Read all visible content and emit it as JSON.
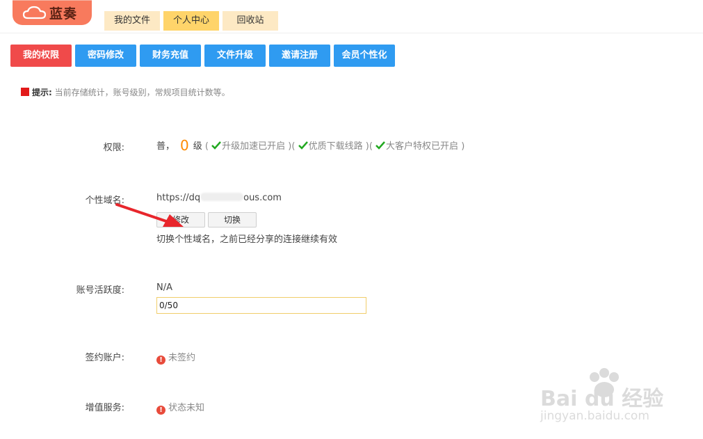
{
  "header": {
    "logo_text": "蓝奏",
    "tabs": [
      {
        "label": "我的文件"
      },
      {
        "label": "个人中心",
        "active": true
      },
      {
        "label": "回收站"
      }
    ]
  },
  "actions": [
    {
      "label": "我的权限",
      "active": true
    },
    {
      "label": "密码修改"
    },
    {
      "label": "财务充值"
    },
    {
      "label": "文件升级"
    },
    {
      "label": "邀请注册"
    },
    {
      "label": "会员个性化"
    }
  ],
  "tip": {
    "prefix": "提示:",
    "text": "当前存储统计，账号级别，常规项目统计数等。"
  },
  "permission": {
    "label": "权限:",
    "tier": "普，",
    "level": "0",
    "level_unit": "级",
    "open_paren": "(",
    "features": [
      "升级加速已开启",
      "优质下载线路",
      "大客户特权已开启"
    ],
    "close_paren": ")"
  },
  "domain": {
    "label": "个性域名:",
    "url_start": "https://dq",
    "url_end": "ous.com",
    "modify_button": "修改",
    "switch_button": "切换",
    "note": "切换个性域名，之前已经分享的连接继续有效"
  },
  "activity": {
    "label": "账号活跃度:",
    "value": "N/A",
    "progress_text": "0/50"
  },
  "contract": {
    "label": "签约账户:",
    "status": "未签约"
  },
  "value_added": {
    "label": "增值服务:",
    "status": "状态未知"
  },
  "watermark": {
    "brand": "Bai du 经验",
    "url": "jingyan.baidu.com"
  },
  "colors": {
    "accent_blue": "#2f9bf1",
    "accent_red": "#f04a4a",
    "level_orange": "#ff8a00",
    "check_green": "#21a820"
  }
}
